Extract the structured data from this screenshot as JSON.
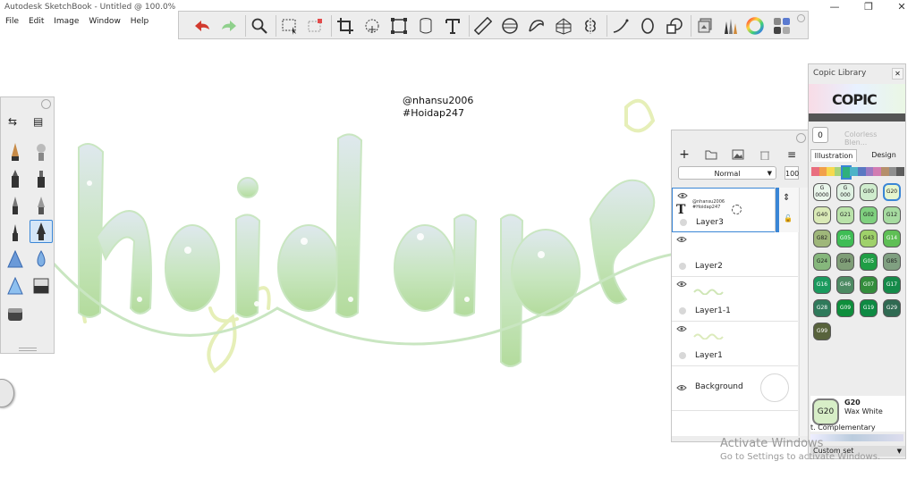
{
  "window": {
    "title": "Autodesk SketchBook - Untitled @ 100.0%",
    "controls": [
      "—",
      "❐",
      "✕"
    ]
  },
  "menu": [
    "File",
    "Edit",
    "Image",
    "Window",
    "Help"
  ],
  "toolbar": {
    "icons": [
      "undo-icon",
      "redo-icon",
      "zoom-icon",
      "select-icon",
      "transform-select-icon",
      "crop-icon",
      "lasso-icon",
      "distort-icon",
      "3d-icon",
      "text-icon",
      "ruler-icon",
      "ellipse-guide-icon",
      "french-curve-icon",
      "perspective-icon",
      "symmetry-icon",
      "line-icon",
      "circle-icon",
      "shape-icon",
      "layer-editor-icon",
      "brush-library-icon",
      "color-wheel-icon",
      "copic-library-icon"
    ]
  },
  "canvas": {
    "text_line1": "@nhansu2006",
    "text_line2": "#Hoidap247",
    "accent": "#b9dca0"
  },
  "lefttools": {
    "tools": [
      "pencil-icon",
      "airbrush-icon",
      "marker-icon",
      "ink-pen-icon",
      "ballpoint-icon",
      "fountain-pen-icon",
      "fine-pen-icon",
      "calligraphy-pen-icon",
      "triangle-brush-icon",
      "drop-brush-icon",
      "chisel-brush-icon",
      "eraser-icon",
      "eraser-soft-icon"
    ]
  },
  "layers": {
    "blend_mode": "Normal",
    "opacity": "100",
    "items": [
      {
        "name": "Layer3",
        "thumb_line1": "@nhansu2006",
        "thumb_line2": "#Hoidap247",
        "selected": true,
        "type": "T"
      },
      {
        "name": "Layer2",
        "selected": false
      },
      {
        "name": "Layer1-1",
        "selected": false
      },
      {
        "name": "Layer1",
        "selected": false
      }
    ],
    "background": "Background"
  },
  "copic": {
    "title": "Copic Library",
    "logo": "COPIC",
    "colorless_num": "0",
    "colorless_label": "Colorless Blen...",
    "tabs": [
      "Illustration",
      "Design"
    ],
    "palette": [
      "#e96e7f",
      "#f2a04a",
      "#f7d94e",
      "#a8d37a",
      "#2fb07c",
      "#4db3c8",
      "#5a78c2",
      "#9c7ac2",
      "#d27cb2",
      "#b58f6b",
      "#8f8f8f",
      "#5d5d5d"
    ],
    "swatches": [
      {
        "code": "G\n0000",
        "color": "#eaf6ec"
      },
      {
        "code": "G\n000",
        "color": "#dff1e2"
      },
      {
        "code": "G00",
        "color": "#cfeccd"
      },
      {
        "code": "G20",
        "color": "#e6f6cf"
      },
      {
        "code": "G40",
        "color": "#d9e9b6"
      },
      {
        "code": "G21",
        "color": "#b9e2a9"
      },
      {
        "code": "G02",
        "color": "#7fd07f"
      },
      {
        "code": "G12",
        "color": "#a6dba0"
      },
      {
        "code": "G82",
        "color": "#9fb77a"
      },
      {
        "code": "G05",
        "color": "#3fbd55"
      },
      {
        "code": "G43",
        "color": "#9fd16a"
      },
      {
        "code": "G14",
        "color": "#5fbf55"
      },
      {
        "code": "G24",
        "color": "#86b77c"
      },
      {
        "code": "G94",
        "color": "#7f9e77"
      },
      {
        "code": "G05",
        "color": "#1f9e45"
      },
      {
        "code": "G85",
        "color": "#80a081"
      },
      {
        "code": "G16",
        "color": "#1a9a5e"
      },
      {
        "code": "G46",
        "color": "#4d8a63"
      },
      {
        "code": "G07",
        "color": "#338d3c"
      },
      {
        "code": "G17",
        "color": "#148a49"
      },
      {
        "code": "G28",
        "color": "#2f7a5b"
      },
      {
        "code": "G09",
        "color": "#0e8e3c"
      },
      {
        "code": "G19",
        "color": "#0e8a43"
      },
      {
        "code": "G29",
        "color": "#2f6a52"
      },
      {
        "code": "G99",
        "color": "#58633c"
      }
    ],
    "selected_code": "G20",
    "selected_name": "Wax White",
    "selected_big": "G20",
    "complementary_label": "t. Complementary",
    "custom_set": "Custom set"
  },
  "watermark": {
    "line1": "Activate Windows",
    "line2": "Go to Settings to activate Windows."
  }
}
